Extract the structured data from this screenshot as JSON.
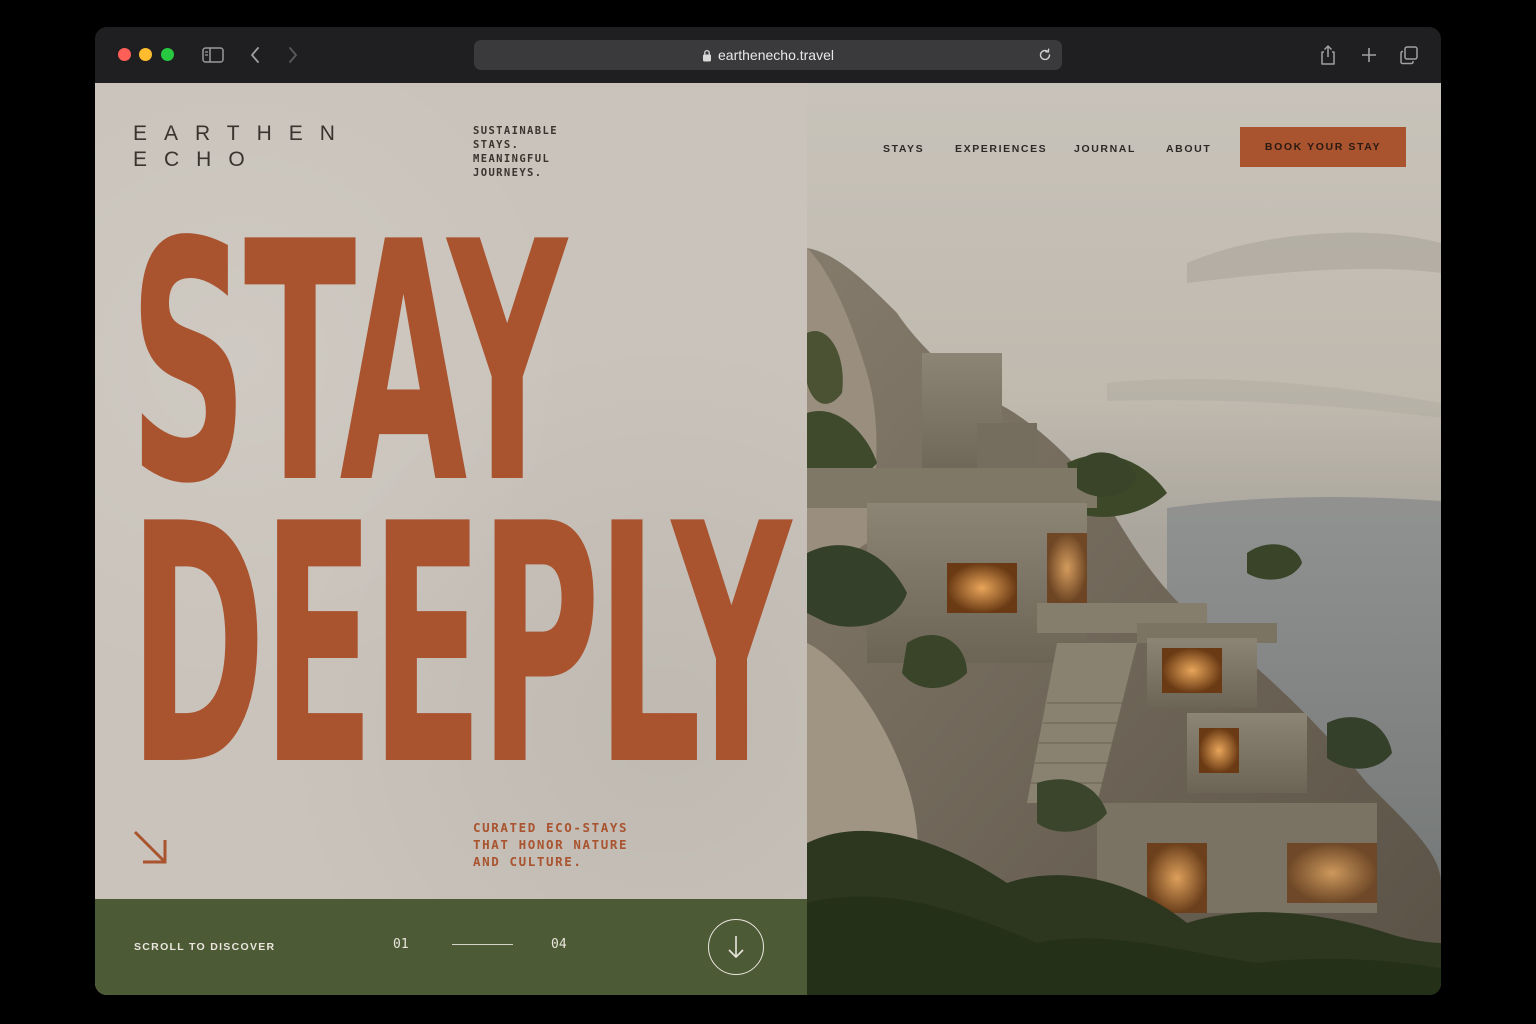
{
  "browser": {
    "url": "earthenecho.travel"
  },
  "brand": {
    "line1": "EARTHEN",
    "line2": "ECHO"
  },
  "tagline": {
    "line1": "SUSTAINABLE",
    "line2": "STAYS.",
    "line3": "MEANINGFUL",
    "line4": "JOURNEYS."
  },
  "hero": {
    "line1": "STAY",
    "line2": "DEEPLY",
    "sub1": "CURATED ECO-STAYS",
    "sub2": "THAT HONOR NATURE",
    "sub3": "AND CULTURE."
  },
  "footer": {
    "scroll_label": "SCROLL TO DISCOVER",
    "page_current": "01",
    "page_total": "04"
  },
  "nav": {
    "items": [
      {
        "label": "STAYS"
      },
      {
        "label": "EXPERIENCES"
      },
      {
        "label": "JOURNAL"
      },
      {
        "label": "ABOUT"
      }
    ],
    "cta": "BOOK YOUR STAY"
  },
  "colors": {
    "accent": "#a9532f",
    "panel_bg": "#c9c3bb",
    "footer_bg": "#4d5a36",
    "ink": "#3a342e"
  },
  "icons": {
    "sidebar": "sidebar-icon",
    "back": "chevron-left-icon",
    "forward": "chevron-right-icon",
    "lock": "lock-icon",
    "reload": "reload-icon",
    "share": "share-icon",
    "new_tab": "plus-icon",
    "tabs": "tabs-overview-icon",
    "diagonal_arrow": "arrow-down-right-icon",
    "scroll": "arrow-down-icon"
  }
}
